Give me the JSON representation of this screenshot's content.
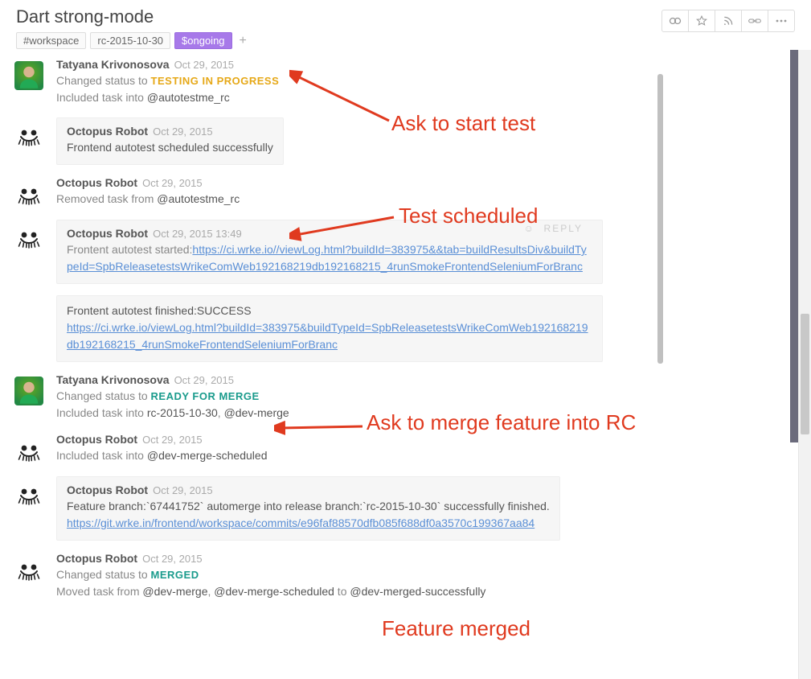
{
  "header": {
    "title": "Dart strong-mode",
    "tags": [
      "#workspace",
      "rc-2015-10-30",
      "$ongoing"
    ]
  },
  "annotations": {
    "ask_start": "Ask to start test",
    "scheduled": "Test scheduled",
    "ask_merge": "Ask to merge feature into RC",
    "merged": "Feature merged"
  },
  "reply_label": "REPLY",
  "entries": [
    {
      "author": "Tatyana Krivonosova",
      "date": "Oct 29, 2015",
      "avatar": "user",
      "boxed": false,
      "lines": [
        {
          "prefix": "Changed status to ",
          "status": "TESTING IN PROGRESS",
          "status_class": "status-testing"
        },
        {
          "prefix": "Included task into ",
          "bold": "@autotestme_rc"
        }
      ]
    },
    {
      "author": "Octopus Robot",
      "date": "Oct 29, 2015",
      "avatar": "bot",
      "boxed": true,
      "lines": [
        {
          "text": "Frontend autotest scheduled successfully"
        }
      ]
    },
    {
      "author": "Octopus Robot",
      "date": "Oct 29, 2015",
      "avatar": "bot",
      "boxed": false,
      "lines": [
        {
          "prefix": "Removed task from ",
          "bold": "@autotestme_rc"
        }
      ]
    },
    {
      "author": "Octopus Robot",
      "date": "Oct 29, 2015 13:49",
      "avatar": "bot",
      "boxed": true,
      "reply": true,
      "lines": [
        {
          "prefix": "Frontent autotest started:",
          "link": "https://ci.wrke.io//viewLog.html?buildId=383975&&tab=buildResultsDiv&buildTypeId=SpbReleasetestsWrikeComWeb192168219db192168215_4runSmokeFrontendSeleniumForBranc"
        }
      ],
      "sub_box": {
        "lines": [
          {
            "text": "Frontent autotest finished:SUCCESS"
          },
          {
            "link": "https://ci.wrke.io/viewLog.html?buildId=383975&buildTypeId=SpbReleasetestsWrikeComWeb192168219db192168215_4runSmokeFrontendSeleniumForBranc"
          }
        ]
      }
    },
    {
      "author": "Tatyana Krivonosova",
      "date": "Oct 29, 2015",
      "avatar": "user",
      "boxed": false,
      "lines": [
        {
          "prefix": "Changed status to ",
          "status": "READY FOR MERGE",
          "status_class": "status-ready"
        },
        {
          "prefix": "Included task into ",
          "bold_multi": [
            "rc-2015-10-30",
            ", ",
            "@dev-merge"
          ]
        }
      ]
    },
    {
      "author": "Octopus Robot",
      "date": "Oct 29, 2015",
      "avatar": "bot",
      "boxed": false,
      "lines": [
        {
          "prefix": "Included task into ",
          "bold": "@dev-merge-scheduled"
        }
      ]
    },
    {
      "author": "Octopus Robot",
      "date": "Oct 29, 2015",
      "avatar": "bot",
      "boxed": true,
      "lines": [
        {
          "text": "Feature branch:`67441752` automerge into release branch:`rc-2015-10-30` successfully finished."
        },
        {
          "link": "https://git.wrke.in/frontend/workspace/commits/e96faf88570dfb085f688df0a3570c199367aa84"
        }
      ]
    },
    {
      "author": "Octopus Robot",
      "date": "Oct 29, 2015",
      "avatar": "bot",
      "boxed": false,
      "lines": [
        {
          "prefix": "Changed status to ",
          "status": "MERGED",
          "status_class": "status-merged"
        },
        {
          "prefix": "Moved task from ",
          "bold_multi": [
            "@dev-merge",
            ", ",
            "@dev-merge-scheduled",
            " to ",
            "@dev-merged-successfully"
          ]
        }
      ]
    }
  ]
}
